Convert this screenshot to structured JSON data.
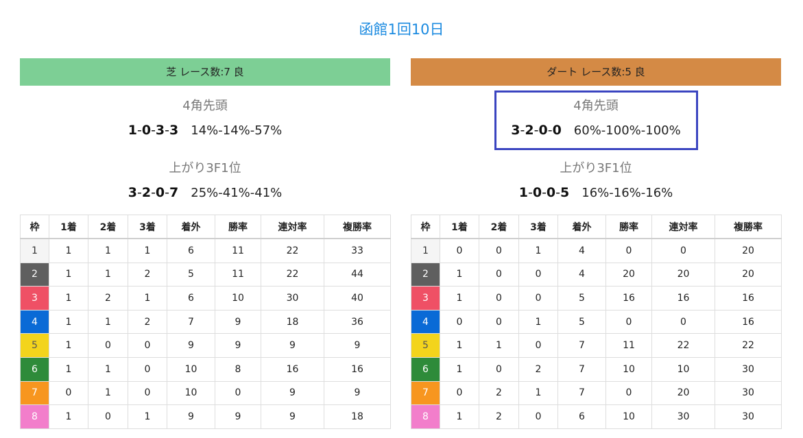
{
  "page_title": "函館1回10日",
  "colors": {
    "title": "#1a8ae0",
    "turf_bar": "#7dcf95",
    "dirt_bar": "#d48a45",
    "highlight_border": "#3a44c0",
    "waku": [
      {
        "bg": "#f5f5f5",
        "fg": "#333333"
      },
      {
        "bg": "#5f5f5f",
        "fg": "#ffffff"
      },
      {
        "bg": "#ef5065",
        "fg": "#ffffff"
      },
      {
        "bg": "#0a6ad6",
        "fg": "#ffffff"
      },
      {
        "bg": "#f3d41c",
        "fg": "#555555"
      },
      {
        "bg": "#2e8b3a",
        "fg": "#ffffff"
      },
      {
        "bg": "#f7961f",
        "fg": "#ffffff"
      },
      {
        "bg": "#f27ecb",
        "fg": "#ffffff"
      }
    ]
  },
  "panels": {
    "shiba": {
      "header": "芝 レース数:7 良",
      "corner_label": "4角先頭",
      "corner_record": [
        "1",
        "0",
        "3",
        "3"
      ],
      "corner_rates": "14%-14%-57%",
      "agari_label": "上がり3F1位",
      "agari_record": [
        "3",
        "2",
        "0",
        "7"
      ],
      "agari_rates": "25%-41%-41%",
      "table": {
        "headers": [
          "枠",
          "1着",
          "2着",
          "3着",
          "着外",
          "勝率",
          "連対率",
          "複勝率"
        ],
        "rows": [
          [
            "1",
            "1",
            "1",
            "1",
            "6",
            "11",
            "22",
            "33"
          ],
          [
            "2",
            "1",
            "1",
            "2",
            "5",
            "11",
            "22",
            "44"
          ],
          [
            "3",
            "1",
            "2",
            "1",
            "6",
            "10",
            "30",
            "40"
          ],
          [
            "4",
            "1",
            "1",
            "2",
            "7",
            "9",
            "18",
            "36"
          ],
          [
            "5",
            "1",
            "0",
            "0",
            "9",
            "9",
            "9",
            "9"
          ],
          [
            "6",
            "1",
            "1",
            "0",
            "10",
            "8",
            "16",
            "16"
          ],
          [
            "7",
            "0",
            "1",
            "0",
            "10",
            "0",
            "9",
            "9"
          ],
          [
            "8",
            "1",
            "0",
            "1",
            "9",
            "9",
            "9",
            "18"
          ]
        ]
      }
    },
    "dirt": {
      "header": "ダート レース数:5 良",
      "corner_label": "4角先頭",
      "corner_record": [
        "3",
        "2",
        "0",
        "0"
      ],
      "corner_rates": "60%-100%-100%",
      "agari_label": "上がり3F1位",
      "agari_record": [
        "1",
        "0",
        "0",
        "5"
      ],
      "agari_rates": "16%-16%-16%",
      "table": {
        "headers": [
          "枠",
          "1着",
          "2着",
          "3着",
          "着外",
          "勝率",
          "連対率",
          "複勝率"
        ],
        "rows": [
          [
            "1",
            "0",
            "0",
            "1",
            "4",
            "0",
            "0",
            "20"
          ],
          [
            "2",
            "1",
            "0",
            "0",
            "4",
            "20",
            "20",
            "20"
          ],
          [
            "3",
            "1",
            "0",
            "0",
            "5",
            "16",
            "16",
            "16"
          ],
          [
            "4",
            "0",
            "0",
            "1",
            "5",
            "0",
            "0",
            "16"
          ],
          [
            "5",
            "1",
            "1",
            "0",
            "7",
            "11",
            "22",
            "22"
          ],
          [
            "6",
            "1",
            "0",
            "2",
            "7",
            "10",
            "10",
            "30"
          ],
          [
            "7",
            "0",
            "2",
            "1",
            "7",
            "0",
            "20",
            "30"
          ],
          [
            "8",
            "1",
            "2",
            "0",
            "6",
            "10",
            "30",
            "30"
          ]
        ]
      }
    }
  }
}
